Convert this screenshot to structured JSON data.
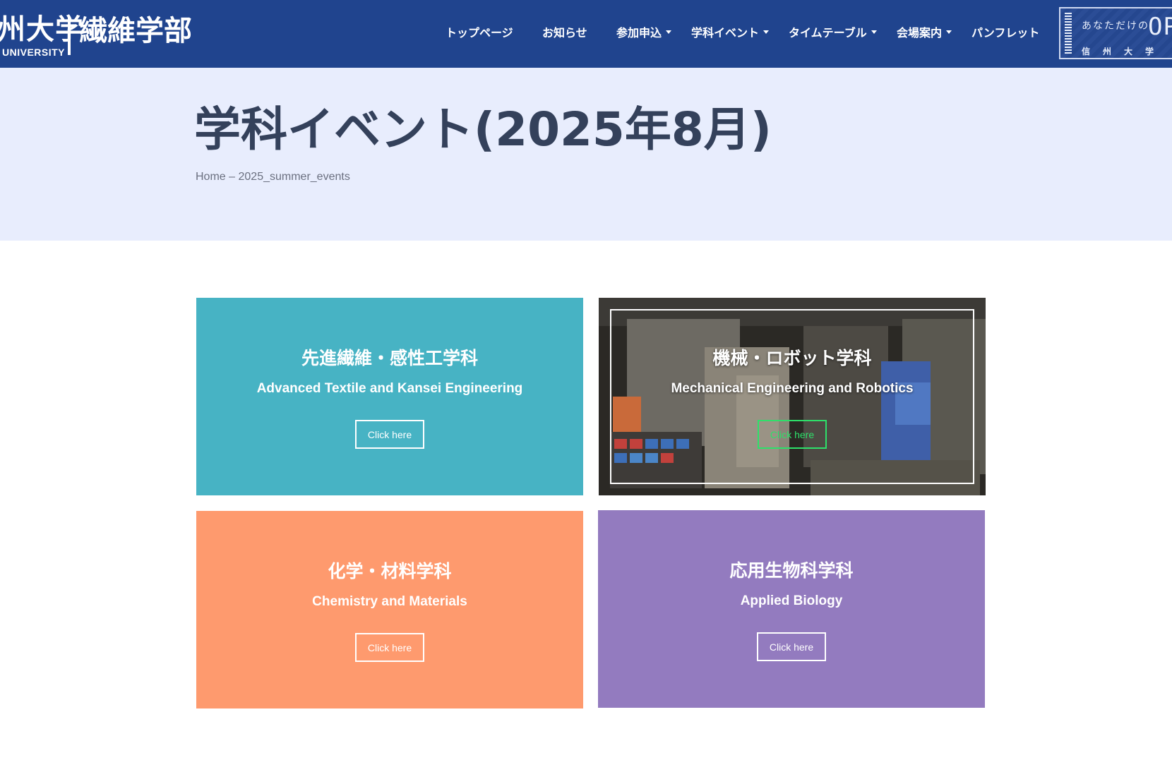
{
  "header": {
    "logo_university": "州大学",
    "logo_university_en": "UNIVERSITY",
    "logo_faculty": "繊維学部",
    "nav": [
      {
        "label": "トップページ",
        "has_dropdown": false
      },
      {
        "label": "お知らせ",
        "has_dropdown": false
      },
      {
        "label": "参加申込",
        "has_dropdown": true
      },
      {
        "label": "学科イベント",
        "has_dropdown": true
      },
      {
        "label": "タイムテーブル",
        "has_dropdown": true
      },
      {
        "label": "会場案内",
        "has_dropdown": true
      },
      {
        "label": "パンフレット",
        "has_dropdown": false
      }
    ],
    "banner": {
      "tagline": "あなただけの",
      "headline": "OPE",
      "subline": "信州大学"
    }
  },
  "hero": {
    "title": "学科イベント(2025年8月)",
    "breadcrumb_home": "Home",
    "breadcrumb_separator": "–",
    "breadcrumb_current": "2025_summer_events"
  },
  "cards": [
    {
      "title_jp": "先進繊維・感性工学科",
      "title_en": "Advanced Textile and Kansei Engineering",
      "button": "Click here",
      "color": "#47b3c4"
    },
    {
      "title_jp": "機械・ロボット学科",
      "title_en": "Mechanical Engineering and Robotics",
      "button": "Click here",
      "color": "#2f2d2a",
      "button_color": "#2ee06a"
    },
    {
      "title_jp": "化学・材料学科",
      "title_en": "Chemistry and Materials",
      "button": "Click here",
      "color": "#fe9a6e"
    },
    {
      "title_jp": "応用生物科学科",
      "title_en": "Applied Biology",
      "button": "Click here",
      "color": "#937bbf"
    }
  ],
  "colors": {
    "header_bg": "#20448e",
    "hero_bg": "#e8edfd",
    "title_text": "#34415b"
  }
}
